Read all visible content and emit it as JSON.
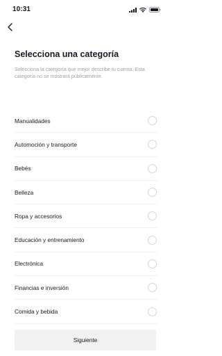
{
  "status_bar": {
    "time": "10:31"
  },
  "header": {
    "back_icon": "chevron-left-icon"
  },
  "main": {
    "title": "Selecciona una categoría",
    "subtitle": "Selecciona la categoría que mejor describe tu cuenta. Esta categoría no se mostrará públicamente.",
    "categories": [
      {
        "label": "Manualidades",
        "selected": false
      },
      {
        "label": "Automoción y transporte",
        "selected": false
      },
      {
        "label": "Bebés",
        "selected": false
      },
      {
        "label": "Belleza",
        "selected": false
      },
      {
        "label": "Ropa y accesorios",
        "selected": false
      },
      {
        "label": "Educación y entrenamiento",
        "selected": false
      },
      {
        "label": "Electrónica",
        "selected": false
      },
      {
        "label": "Financias e inversión",
        "selected": false
      },
      {
        "label": "Comida y bebida",
        "selected": false
      }
    ]
  },
  "footer": {
    "next_label": "Siguiente"
  },
  "colors": {
    "text_primary": "#161823",
    "text_secondary": "#a0a1a7",
    "button_bg": "#f1f1f2",
    "radio_border": "#d6d6d9"
  }
}
